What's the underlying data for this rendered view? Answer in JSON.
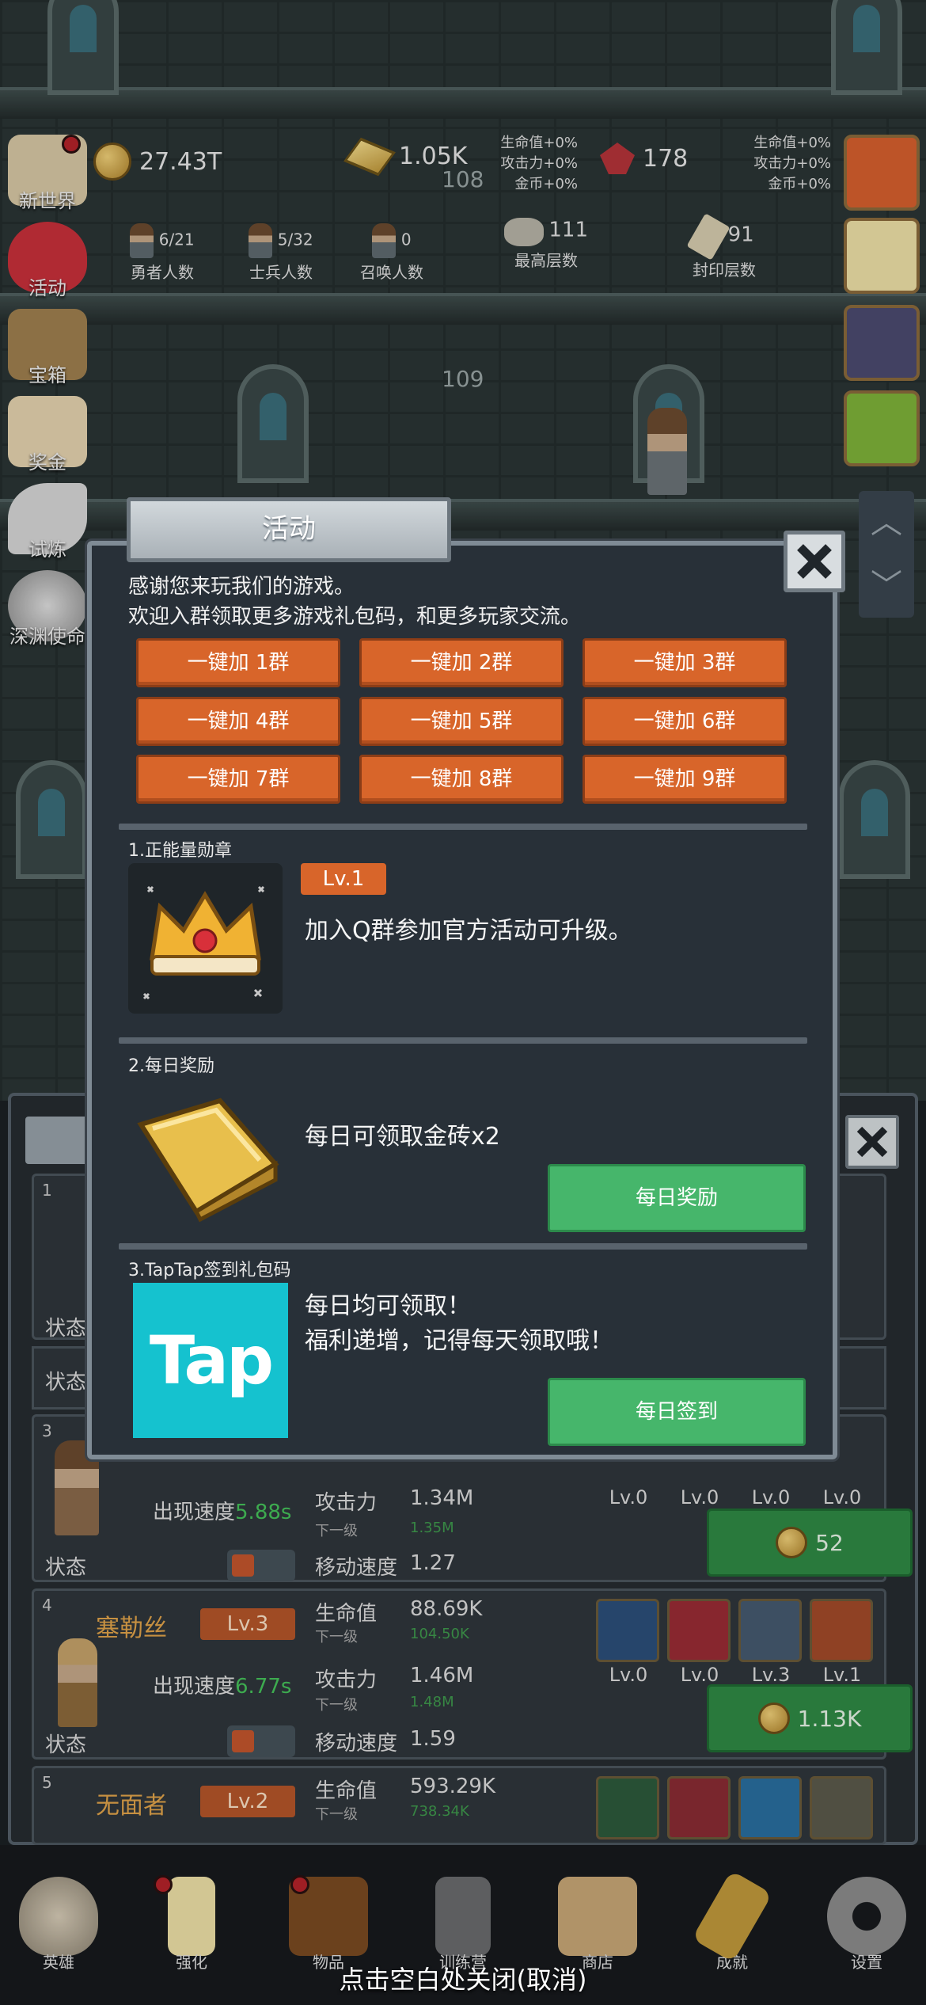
{
  "floors": [
    "108",
    "109"
  ],
  "resources": {
    "gold": "27.43T",
    "bars": "1.05K",
    "gems": "178",
    "bonus_left": [
      "生命值+0%",
      "攻击力+0%",
      "金币+0%"
    ],
    "bonus_right": [
      "生命值+0%",
      "攻击力+0%",
      "金币+0%"
    ]
  },
  "counts": [
    {
      "num": "6/21",
      "label": "勇者人数"
    },
    {
      "num": "5/32",
      "label": "士兵人数"
    },
    {
      "num": "0",
      "label": "召唤人数"
    },
    {
      "num": "111",
      "label": "最高层数"
    },
    {
      "num": "91",
      "label": "封印层数"
    }
  ],
  "left_menu": [
    "新世界",
    "活动",
    "宝箱",
    "奖金",
    "试炼",
    "深渊使命"
  ],
  "dialog": {
    "title": "活动",
    "intro_1": "感谢您来玩我们的游戏。",
    "intro_2": "欢迎入群领取更多游戏礼包码，和更多玩家交流。",
    "group_buttons": [
      "一键加 1群",
      "一键加 2群",
      "一键加 3群",
      "一键加 4群",
      "一键加 5群",
      "一键加 6群",
      "一键加 7群",
      "一键加 8群",
      "一键加 9群"
    ],
    "sections": [
      {
        "title": "1.正能量勋章",
        "level": "Lv.1",
        "desc": "加入Q群参加官方活动可升级。"
      },
      {
        "title": "2.每日奖励",
        "desc": "每日可领取金砖x2",
        "button": "每日奖励"
      },
      {
        "title": "3.TapTap签到礼包码",
        "desc_1": "每日均可领取！",
        "desc_2": "福利递增，记得每天领取哦！",
        "button": "每日签到",
        "logo_text": "Tap"
      }
    ]
  },
  "hero_list": {
    "state_label": "状态",
    "speed_label": "出现速度",
    "next_label": "下一级",
    "heroes": [
      {
        "index": "1"
      },
      {
        "index": "3",
        "speed": "5.88s",
        "attack": "1.34M",
        "attack_next": "1.35M",
        "move": "1.27",
        "cost": "52",
        "equip_levels": [
          "Lv.0",
          "Lv.0",
          "Lv.0",
          "Lv.0"
        ]
      },
      {
        "index": "4",
        "name": "塞勒丝",
        "level": "Lv.3",
        "speed": "6.77s",
        "hp": "88.69K",
        "hp_next": "104.50K",
        "attack": "1.46M",
        "attack_next": "1.48M",
        "move": "1.59",
        "cost": "1.13K",
        "equip_levels": [
          "Lv.0",
          "Lv.0",
          "Lv.3",
          "Lv.1"
        ]
      },
      {
        "index": "5",
        "name": "无面者",
        "level": "Lv.2",
        "hp": "593.29K",
        "hp_next": "738.34K"
      }
    ],
    "attr_labels": {
      "hp": "生命值",
      "attack": "攻击力",
      "move": "移动速度"
    }
  },
  "bottom_nav": [
    "英雄",
    "强化",
    "物品",
    "训练营",
    "商店",
    "成就",
    "设置"
  ],
  "close_hint": "点击空白处关闭(取消)",
  "colors": {
    "orange": "#d8652a",
    "green": "#46b66b",
    "tap": "#15c2cf"
  }
}
